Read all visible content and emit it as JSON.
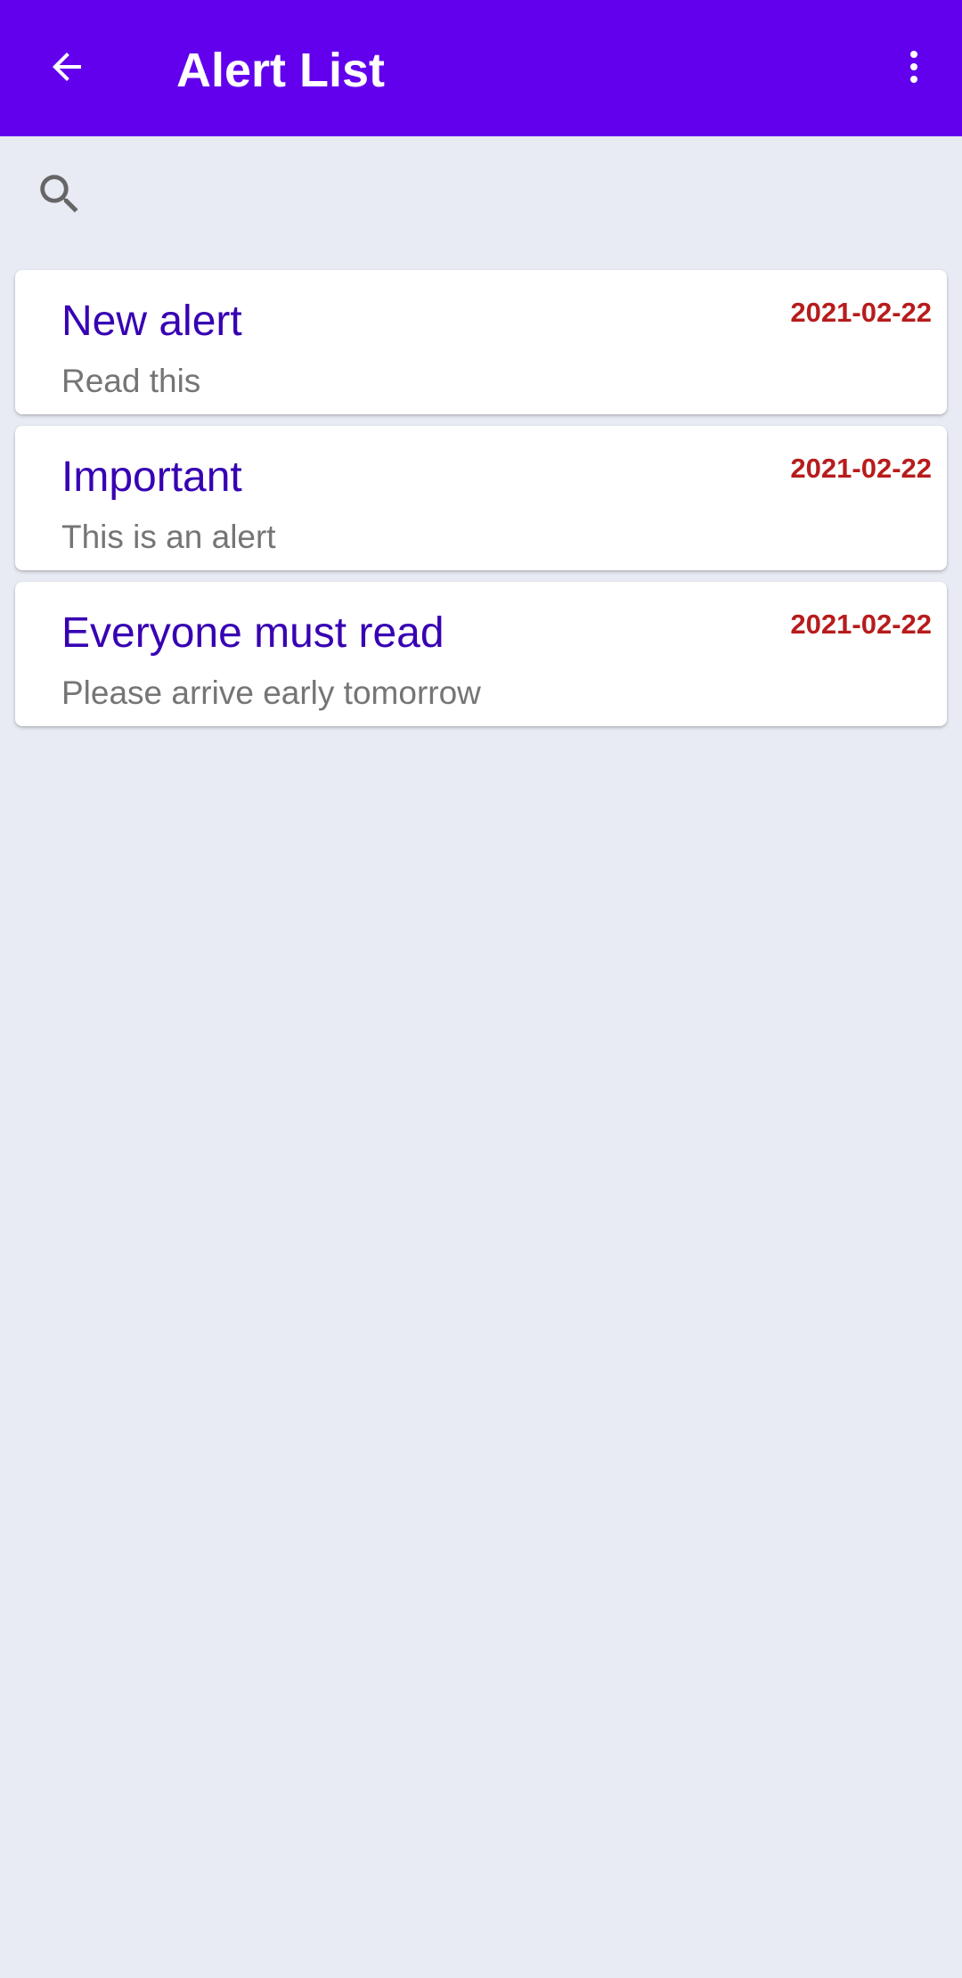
{
  "app_bar": {
    "title": "Alert List",
    "back_icon": "arrow-back-icon",
    "overflow_icon": "more-vert-icon",
    "color": "#6200ee"
  },
  "search": {
    "icon": "search-icon",
    "value": "",
    "placeholder": ""
  },
  "alerts": [
    {
      "title": "New alert",
      "body": "Read this",
      "date": "2021-02-22"
    },
    {
      "title": "Important",
      "body": "This is an alert",
      "date": "2021-02-22"
    },
    {
      "title": "Everyone must read",
      "body": "Please arrive early tomorrow",
      "date": "2021-02-22"
    }
  ],
  "colors": {
    "title_text": "#3700b3",
    "date_text": "#b71c1c",
    "body_text": "#757575",
    "background": "#e8ebf3"
  }
}
